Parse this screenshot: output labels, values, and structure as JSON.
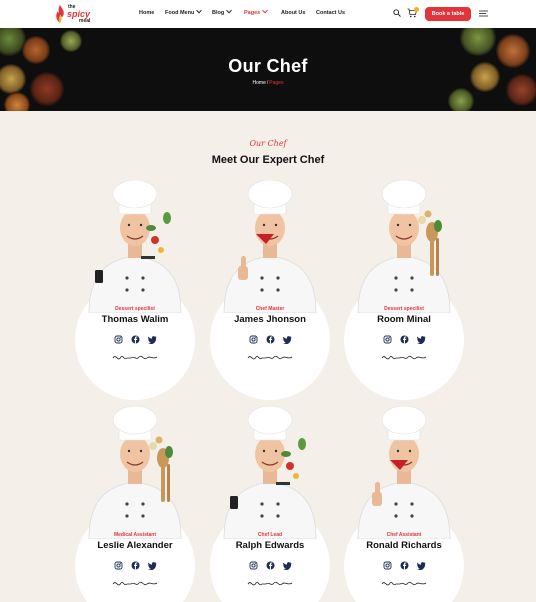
{
  "header": {
    "logo": {
      "line1": "the",
      "line2": "spicy",
      "line3": "meal"
    },
    "nav": [
      {
        "label": "Home",
        "has_dropdown": false,
        "active": false
      },
      {
        "label": "Food Menu",
        "has_dropdown": true,
        "active": false
      },
      {
        "label": "Blog",
        "has_dropdown": true,
        "active": false
      },
      {
        "label": "Pages",
        "has_dropdown": true,
        "active": true
      },
      {
        "label": "About Us",
        "has_dropdown": false,
        "active": false
      },
      {
        "label": "Contact Us",
        "has_dropdown": false,
        "active": false
      }
    ],
    "icons": [
      "search-icon",
      "cart-icon",
      "hamburger-menu-icon"
    ],
    "book_button": "Book a table"
  },
  "hero": {
    "title": "Our Chef",
    "breadcrumb": {
      "home": "Home",
      "separator": "/",
      "current": "Pages"
    }
  },
  "section": {
    "eyebrow": "Our Chef",
    "title": "Meet Our Expert Chef"
  },
  "chefs": [
    {
      "role": "Dessert specilist",
      "name": "Thomas Walim",
      "pose": "phone-veg"
    },
    {
      "role": "Chef Master",
      "name": "James Jhonson",
      "pose": "thumbs-up"
    },
    {
      "role": "Dessert specilist",
      "name": "Room Minal",
      "pose": "spatula"
    },
    {
      "role": "Medical Assistant",
      "name": "Leslie Alexander",
      "pose": "spatula"
    },
    {
      "role": "Chef Lead",
      "name": "Ralph Edwards",
      "pose": "phone-veg"
    },
    {
      "role": "Chef Assistant",
      "name": "Ronald Richards",
      "pose": "thumbs-up"
    }
  ],
  "social_icons": [
    "instagram-icon",
    "facebook-icon",
    "twitter-icon"
  ],
  "colors": {
    "accent": "#e4343b",
    "page_bg": "#f4efe8",
    "hero_bg": "#0e0e0e",
    "card_bg": "#ffffff",
    "social": "#1d2b57",
    "badge": "#f5b021"
  }
}
